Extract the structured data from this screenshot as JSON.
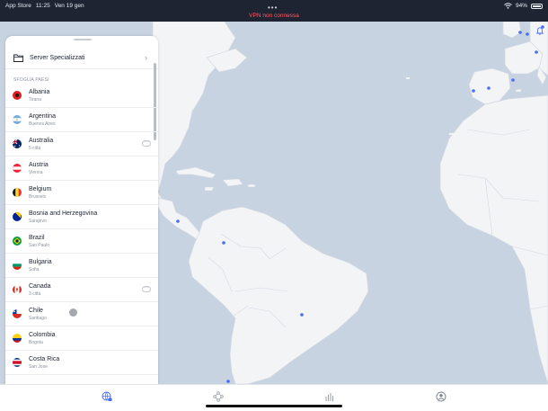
{
  "status_bar": {
    "carrier": "App Store",
    "time": "11:25",
    "date": "Ven 19 gen",
    "vpn_status": "VPN non connessa",
    "battery": "94%"
  },
  "panel": {
    "specialized_servers": "Server Specializzati",
    "section_title": "SFOGLIA PAESI",
    "countries": [
      {
        "name": "Albania",
        "sub": "Tirana"
      },
      {
        "name": "Argentina",
        "sub": "Buenos Aires"
      },
      {
        "name": "Australia",
        "sub": "5 città"
      },
      {
        "name": "Austria",
        "sub": "Vienna"
      },
      {
        "name": "Belgium",
        "sub": "Brussels"
      },
      {
        "name": "Bosnia and Herzegovina",
        "sub": "Sarajevo"
      },
      {
        "name": "Brazil",
        "sub": "Sao Paulo"
      },
      {
        "name": "Bulgaria",
        "sub": "Sofia"
      },
      {
        "name": "Canada",
        "sub": "3 città"
      },
      {
        "name": "Chile",
        "sub": "Santiago"
      },
      {
        "name": "Colombia",
        "sub": "Bogota"
      },
      {
        "name": "Costa Rica",
        "sub": "San Jose"
      }
    ]
  },
  "colors": {
    "accent": "#4a6cf7",
    "status_red": "#ff5a63",
    "map_water": "#c7d3e1",
    "map_land": "#f3f4f6"
  },
  "icons": {
    "bell": "bell-icon",
    "folder": "folder-icon",
    "tabs": [
      "vpn-globe-icon",
      "meshnet-icon",
      "stats-icon",
      "profile-icon"
    ]
  }
}
